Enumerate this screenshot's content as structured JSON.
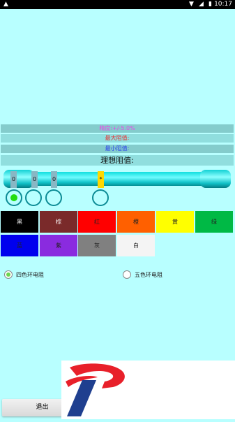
{
  "status_bar": {
    "time": "10:17"
  },
  "info": {
    "precision": "精度:+/-5.0%",
    "max_value": "最大阻值:",
    "min_value": "最小阻值:",
    "ideal_value": "理想阻值:"
  },
  "colors": {
    "precision_text": "#e84ce8",
    "max_text": "#e83030",
    "min_text": "#2a40ee",
    "background": "#b8ffff"
  },
  "bands": {
    "b1": "0",
    "b2": "0",
    "b3": "0",
    "b4": "*"
  },
  "color_buttons": [
    {
      "label": "黑",
      "bg": "#000000",
      "fg": "#ffffff"
    },
    {
      "label": "棕",
      "bg": "#7a2a2a",
      "fg": "#ffffff"
    },
    {
      "label": "红",
      "bg": "#ff0000",
      "fg": "#222222"
    },
    {
      "label": "橙",
      "bg": "#ff6000",
      "fg": "#222222"
    },
    {
      "label": "黄",
      "bg": "#ffff00",
      "fg": "#222222"
    },
    {
      "label": "绿",
      "bg": "#00b945",
      "fg": "#222222"
    },
    {
      "label": "蓝",
      "bg": "#0000ee",
      "fg": "#222222"
    },
    {
      "label": "紫",
      "bg": "#8a2bdf",
      "fg": "#222222"
    },
    {
      "label": "灰",
      "bg": "#808080",
      "fg": "#222222"
    },
    {
      "label": "白",
      "bg": "#f4f4f4",
      "fg": "#222222"
    }
  ],
  "modes": {
    "four_band": "四色环电阻",
    "five_band": "五色环电阻"
  },
  "exit_label": "退出"
}
